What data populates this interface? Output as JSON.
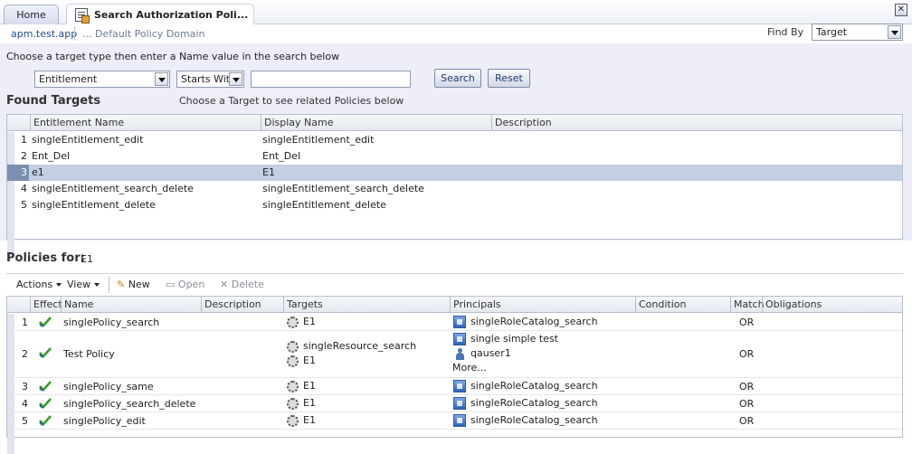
{
  "tabs": {
    "home": "Home",
    "active": "Search Authorization Poli..."
  },
  "header": {
    "app": "apm.test.app",
    "domain": "... Default Policy Domain",
    "find_by_label": "Find By",
    "find_by_value": "Target"
  },
  "search": {
    "instruction": "Choose a target type then enter a Name value in the search below",
    "type_value": "Entitlement",
    "operator_value": "Starts With",
    "name_value": "",
    "search_label": "Search",
    "reset_label": "Reset"
  },
  "found_targets": {
    "title": "Found Targets",
    "hint": "Choose a Target to see related Policies below",
    "columns": [
      "Entitlement Name",
      "Display Name",
      "Description"
    ],
    "rows": [
      {
        "num": "1",
        "name": "singleEntitlement_edit",
        "display": "singleEntitlement_edit",
        "desc": ""
      },
      {
        "num": "2",
        "name": "Ent_Del",
        "display": "Ent_Del",
        "desc": ""
      },
      {
        "num": "3",
        "name": "e1",
        "display": "E1",
        "desc": ""
      },
      {
        "num": "4",
        "name": "singleEntitlement_search_delete",
        "display": "singleEntitlement_search_delete",
        "desc": ""
      },
      {
        "num": "5",
        "name": "singleEntitlement_delete",
        "display": "singleEntitlement_delete",
        "desc": ""
      }
    ]
  },
  "policies": {
    "title": "Policies for:",
    "target": "E1",
    "toolbar": {
      "actions": "Actions",
      "view": "View",
      "new": "New",
      "open": "Open",
      "delete": "Delete"
    },
    "columns": [
      "Effect",
      "Name",
      "Description",
      "Targets",
      "Principals",
      "Condition",
      "Match",
      "Obligations"
    ],
    "rows": [
      {
        "num": "1",
        "name": "singlePolicy_search",
        "targets": [
          "E1"
        ],
        "principals": [
          "singleRoleCatalog_search"
        ],
        "match": "OR"
      },
      {
        "num": "2",
        "name": "Test Policy",
        "targets": [
          "singleResource_search",
          "E1"
        ],
        "principals": [
          "single simple test",
          "qauser1"
        ],
        "more": "More...",
        "match": "OR"
      },
      {
        "num": "3",
        "name": "singlePolicy_same",
        "targets": [
          "E1"
        ],
        "principals": [
          "singleRoleCatalog_search"
        ],
        "match": "OR"
      },
      {
        "num": "4",
        "name": "singlePolicy_search_delete",
        "targets": [
          "E1"
        ],
        "principals": [
          "singleRoleCatalog_search"
        ],
        "match": "OR"
      },
      {
        "num": "5",
        "name": "singlePolicy_edit",
        "targets": [
          "E1"
        ],
        "principals": [
          "singleRoleCatalog_search"
        ],
        "match": "OR"
      }
    ]
  }
}
